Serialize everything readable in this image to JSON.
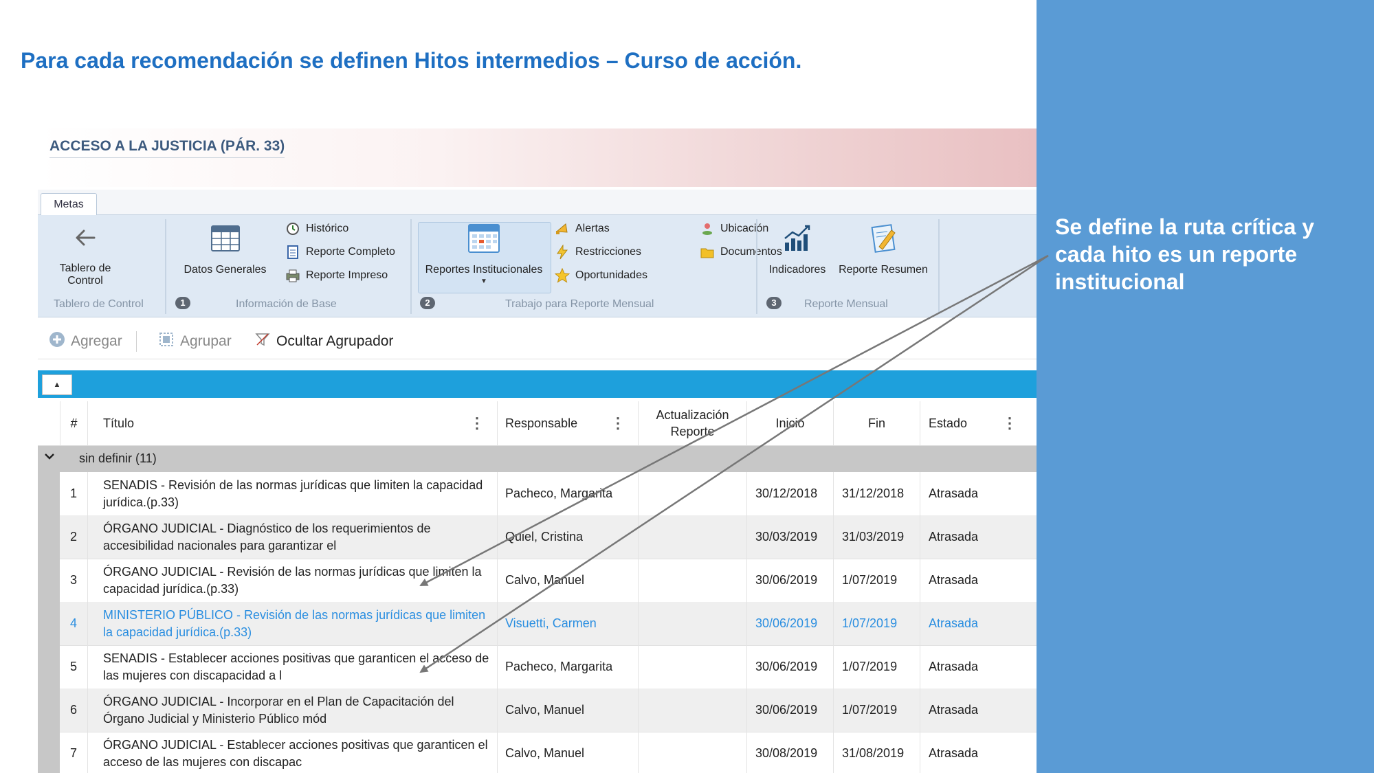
{
  "slide": {
    "title": "Para cada recomendación se definen Hitos intermedios – Curso de acción.",
    "side_note": "Se define la ruta crítica y cada hito es un reporte institucional"
  },
  "app": {
    "title": "ACCESO A LA JUSTICIA (PÁR. 33)",
    "tabs": [
      "Metas"
    ],
    "ribbon": {
      "tablero_de_control": "Tablero de Control",
      "datos_generales": "Datos Generales",
      "historico": "Histórico",
      "reporte_completo": "Reporte Completo",
      "reporte_impreso": "Reporte Impreso",
      "reportes_institucionales": "Reportes Institucionales",
      "alertas": "Alertas",
      "restricciones": "Restricciones",
      "oportunidades": "Oportunidades",
      "ubicacion": "Ubicación",
      "documentos": "Documentos",
      "indicadores": "Indicadores",
      "reporte_resumen": "Reporte Resumen",
      "groups": {
        "g0": "Tablero de Control",
        "g1_num": "1",
        "g1": "Información de Base",
        "g2_num": "2",
        "g2": "Trabajo para Reporte Mensual",
        "g3_num": "3",
        "g3": "Reporte Mensual"
      }
    },
    "toolbar": {
      "agregar": "Agregar",
      "agrupar": "Agrupar",
      "ocultar_agrupador": "Ocultar Agrupador"
    },
    "table": {
      "collapse_symbol": "▲",
      "headers": {
        "num": "#",
        "titulo": "Título",
        "responsable": "Responsable",
        "actualizacion_line1": "Actualización",
        "actualizacion_line2": "Reporte",
        "inicio": "Inicio",
        "fin": "Fin",
        "estado": "Estado"
      },
      "group_label": "sin definir (11)",
      "rows": [
        {
          "num": "1",
          "title": "SENADIS - Revisión de las normas jurídicas que limiten la capacidad jurídica.(p.33)",
          "responsable": "Pacheco, Margarita",
          "actualizacion": "",
          "inicio": "30/12/2018",
          "fin": "31/12/2018",
          "estado": "Atrasada"
        },
        {
          "num": "2",
          "title": "ÓRGANO JUDICIAL - Diagnóstico de los requerimientos de accesibilidad nacionales para garantizar el",
          "responsable": "Quiel, Cristina",
          "actualizacion": "",
          "inicio": "30/03/2019",
          "fin": "31/03/2019",
          "estado": "Atrasada"
        },
        {
          "num": "3",
          "title": "ÓRGANO JUDICIAL - Revisión de las normas jurídicas que limiten la capacidad jurídica.(p.33)",
          "responsable": "Calvo, Manuel",
          "actualizacion": "",
          "inicio": "30/06/2019",
          "fin": "1/07/2019",
          "estado": "Atrasada"
        },
        {
          "num": "4",
          "title": "MINISTERIO PÚBLICO - Revisión de las normas jurídicas que limiten la capacidad jurídica.(p.33)",
          "responsable": "Visuetti, Carmen",
          "actualizacion": "",
          "inicio": "30/06/2019",
          "fin": "1/07/2019",
          "estado": "Atrasada"
        },
        {
          "num": "5",
          "title": "SENADIS - Establecer acciones positivas que garanticen el acceso de las mujeres con discapacidad a l",
          "responsable": "Pacheco, Margarita",
          "actualizacion": "",
          "inicio": "30/06/2019",
          "fin": "1/07/2019",
          "estado": "Atrasada"
        },
        {
          "num": "6",
          "title": "ÓRGANO JUDICIAL - Incorporar en el Plan de Capacitación del Órgano Judicial y Ministerio Público mód",
          "responsable": "Calvo, Manuel",
          "actualizacion": "",
          "inicio": "30/06/2019",
          "fin": "1/07/2019",
          "estado": "Atrasada"
        },
        {
          "num": "7",
          "title": "ÓRGANO JUDICIAL - Establecer acciones positivas que garanticen el acceso de las mujeres con discapac",
          "responsable": "Calvo, Manuel",
          "actualizacion": "",
          "inicio": "30/08/2019",
          "fin": "31/08/2019",
          "estado": "Atrasada"
        }
      ]
    }
  },
  "colors": {
    "title_blue": "#1e6fc2",
    "side_panel": "#5a9bd5",
    "grid_bar": "#1ea0dc",
    "highlight_row": "#2a8ee0",
    "arrow": "#777777"
  },
  "icons": {
    "back": "arrow-left-icon",
    "datos": "table-grid-icon",
    "historico": "clock-history-icon",
    "reporte_completo": "document-icon",
    "reporte_impreso": "printer-icon",
    "reportes_institucionales": "calendar-icon",
    "alertas": "horn-icon",
    "restricciones": "lightning-icon",
    "oportunidades": "star-icon",
    "ubicacion": "person-pin-icon",
    "documentos": "folder-icon",
    "indicadores": "bar-chart-icon",
    "reporte_resumen": "edit-document-icon",
    "agregar": "plus-circle-icon",
    "agrupar": "group-icon",
    "ocultar": "funnel-hide-icon",
    "collapse": "caret-up-icon",
    "group_toggle": "chevron-down-icon"
  }
}
